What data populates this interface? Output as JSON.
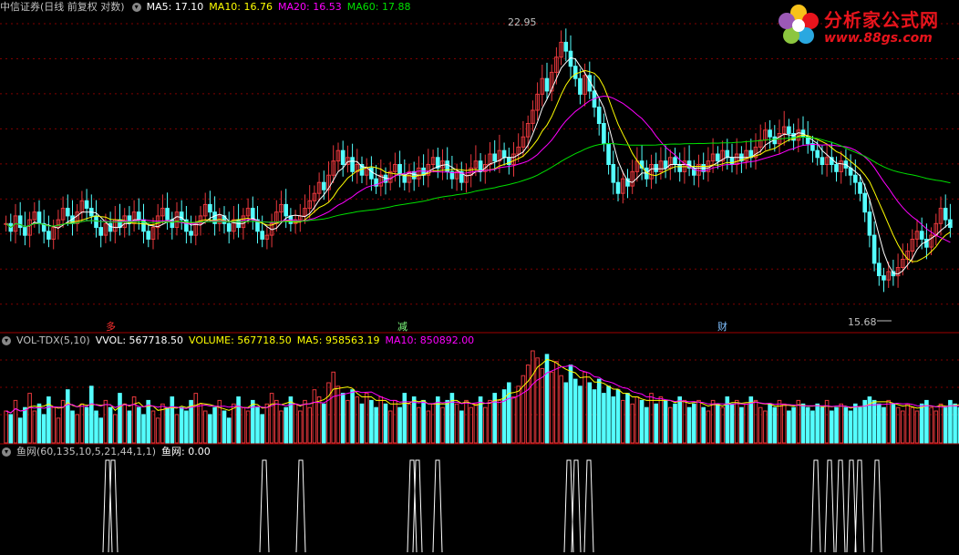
{
  "main_panel": {
    "title": "中信证券(日线 前复权 对数)",
    "ma5_label": "MA5: 17.10",
    "ma10_label": "MA10: 16.76",
    "ma20_label": "MA20: 16.53",
    "ma60_label": "MA60: 17.88",
    "high_label": "22.95",
    "low_label": "15.68",
    "markers": [
      "多",
      "减",
      "财"
    ]
  },
  "volume_panel": {
    "title": "VOL-TDX(5,10)",
    "vvol_label": "VVOL: 567718.50",
    "volume_label": "VOLUME: 567718.50",
    "ma5_label": "MA5: 958563.19",
    "ma10_label": "MA10: 850892.00"
  },
  "fish_panel": {
    "title": "鱼网(60,135,10,5,21,44,1,1)",
    "value_label": "鱼网: 0.00"
  },
  "logo": {
    "title": "分析家公式网",
    "url": "www.88gs.com"
  },
  "colors": {
    "background": "#000000",
    "up": "#e8383d",
    "down": "#54ffff",
    "ma5": "#ffffff",
    "ma10": "#ffff00",
    "ma20": "#ff00ff",
    "ma60": "#00e000",
    "grid": "#800000"
  },
  "chart_data": {
    "type": "candlestick",
    "y_scale": "log",
    "ylim": [
      15.0,
      23.5
    ],
    "close": [
      17.2,
      17.0,
      17.4,
      17.1,
      16.9,
      17.3,
      17.5,
      17.2,
      17.0,
      16.8,
      17.1,
      17.3,
      17.6,
      17.4,
      17.2,
      17.5,
      17.8,
      17.6,
      17.4,
      17.1,
      16.9,
      17.2,
      17.0,
      17.3,
      17.1,
      17.4,
      17.2,
      17.5,
      17.3,
      17.0,
      16.8,
      17.1,
      17.4,
      17.6,
      17.3,
      17.1,
      17.5,
      17.3,
      17.0,
      16.9,
      17.2,
      17.4,
      17.7,
      17.5,
      17.2,
      17.4,
      17.2,
      17.0,
      17.3,
      17.1,
      17.4,
      17.6,
      17.3,
      17.0,
      16.8,
      16.9,
      17.2,
      17.5,
      17.7,
      17.4,
      17.2,
      17.3,
      17.4,
      17.6,
      17.8,
      18.0,
      18.3,
      18.1,
      18.5,
      18.9,
      19.2,
      18.8,
      19.0,
      18.6,
      18.8,
      18.5,
      18.7,
      18.4,
      18.2,
      18.5,
      18.3,
      18.6,
      18.8,
      18.5,
      18.3,
      18.6,
      18.4,
      18.7,
      18.5,
      18.8,
      19.0,
      18.7,
      18.9,
      18.6,
      18.4,
      18.6,
      18.3,
      18.5,
      18.7,
      18.9,
      18.6,
      18.8,
      19.1,
      18.9,
      19.2,
      19.0,
      18.8,
      19.1,
      19.3,
      19.6,
      20.0,
      20.4,
      20.9,
      21.4,
      21.0,
      21.6,
      22.1,
      22.6,
      22.3,
      21.8,
      21.4,
      20.9,
      21.5,
      21.0,
      20.5,
      20.0,
      19.4,
      18.8,
      18.3,
      18.0,
      18.4,
      18.2,
      18.6,
      18.9,
      18.7,
      18.4,
      18.8,
      18.6,
      18.9,
      18.7,
      19.0,
      18.8,
      18.6,
      18.9,
      18.7,
      18.5,
      18.8,
      18.6,
      18.9,
      19.1,
      18.9,
      19.2,
      19.0,
      18.8,
      19.1,
      18.9,
      19.2,
      19.0,
      19.3,
      19.5,
      19.8,
      19.6,
      19.4,
      19.7,
      19.9,
      19.7,
      19.5,
      19.8,
      19.6,
      19.4,
      19.2,
      19.0,
      18.8,
      19.0,
      18.8,
      18.6,
      18.9,
      18.7,
      18.5,
      18.3,
      18.0,
      17.5,
      16.9,
      16.2,
      15.9,
      15.8,
      16.0,
      15.9,
      16.1,
      16.3,
      16.5,
      16.8,
      17.0,
      16.8,
      16.6,
      16.9,
      17.2,
      17.6,
      17.3,
      17.1
    ],
    "ma_lines": [
      "MA5",
      "MA10",
      "MA20",
      "MA60"
    ],
    "volume": [
      9,
      8,
      12,
      7,
      10,
      14,
      9,
      11,
      8,
      13,
      10,
      7,
      12,
      15,
      9,
      8,
      11,
      10,
      16,
      9,
      7,
      12,
      10,
      8,
      14,
      11,
      9,
      13,
      10,
      8,
      12,
      9,
      7,
      11,
      10,
      13,
      8,
      10,
      9,
      12,
      14,
      11,
      9,
      8,
      10,
      12,
      9,
      7,
      11,
      13,
      10,
      9,
      12,
      10,
      8,
      11,
      14,
      12,
      9,
      10,
      13,
      11,
      9,
      12,
      10,
      15,
      13,
      11,
      17,
      20,
      16,
      14,
      12,
      15,
      13,
      11,
      14,
      12,
      10,
      13,
      11,
      9,
      12,
      10,
      14,
      11,
      13,
      10,
      12,
      9,
      11,
      13,
      10,
      12,
      14,
      11,
      9,
      12,
      10,
      11,
      13,
      10,
      12,
      14,
      12,
      15,
      17,
      13,
      16,
      19,
      22,
      26,
      24,
      21,
      25,
      20,
      23,
      19,
      17,
      22,
      18,
      16,
      20,
      17,
      15,
      18,
      14,
      16,
      13,
      15,
      12,
      14,
      11,
      13,
      12,
      10,
      14,
      11,
      13,
      12,
      10,
      11,
      13,
      12,
      10,
      11,
      12,
      10,
      9,
      12,
      11,
      10,
      13,
      11,
      12,
      10,
      11,
      13,
      12,
      10,
      9,
      11,
      10,
      12,
      11,
      9,
      10,
      12,
      11,
      10,
      9,
      11,
      10,
      12,
      9,
      10,
      11,
      10,
      9,
      11,
      10,
      12,
      13,
      12,
      11,
      10,
      12,
      11,
      10,
      9,
      11,
      10,
      9,
      11,
      12,
      10,
      9,
      11,
      10,
      12,
      11,
      10
    ],
    "fish_signals_x": [
      118,
      124,
      290,
      330,
      452,
      458,
      480,
      624,
      632,
      646,
      895,
      910,
      922,
      934,
      943,
      962
    ]
  }
}
